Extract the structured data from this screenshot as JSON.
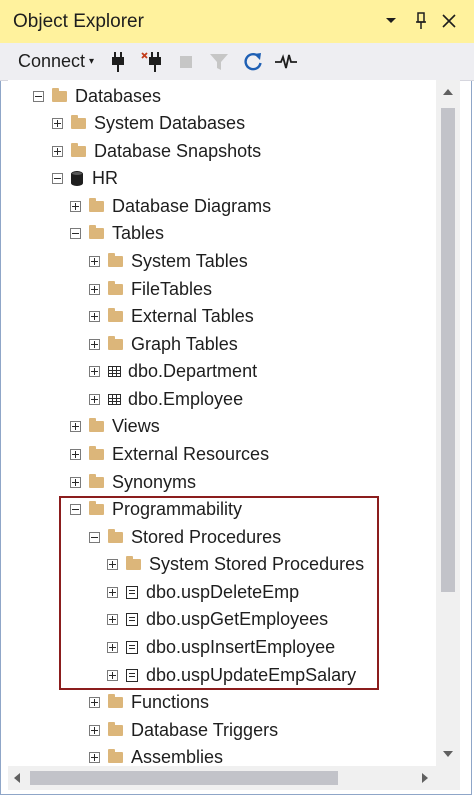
{
  "window": {
    "title": "Object Explorer",
    "dropdown_glyph": "▾",
    "pin_glyph": "📌",
    "close_glyph": "✕"
  },
  "toolbar": {
    "connect_label": "Connect",
    "caret": "▾",
    "icons": [
      "connect-plug-icon",
      "disconnect-plug-icon",
      "stop-icon",
      "filter-icon",
      "refresh-icon",
      "activity-monitor-icon"
    ]
  },
  "tree": {
    "databases": "Databases",
    "system_databases": "System Databases",
    "database_snapshots": "Database Snapshots",
    "hr": "HR",
    "database_diagrams": "Database Diagrams",
    "tables": "Tables",
    "system_tables": "System Tables",
    "file_tables": "FileTables",
    "external_tables": "External Tables",
    "graph_tables": "Graph Tables",
    "dbo_department": "dbo.Department",
    "dbo_employee": "dbo.Employee",
    "views": "Views",
    "external_resources": "External Resources",
    "synonyms": "Synonyms",
    "programmability": "Programmability",
    "stored_procedures": "Stored Procedures",
    "system_stored_procedures": "System Stored Procedures",
    "usp_delete_emp": "dbo.uspDeleteEmp",
    "usp_get_employees": "dbo.uspGetEmployees",
    "usp_insert_employee": "dbo.uspInsertEmployee",
    "usp_update_emp_salary": "dbo.uspUpdateEmpSalary",
    "functions": "Functions",
    "database_triggers": "Database Triggers",
    "assemblies": "Assemblies"
  },
  "colors": {
    "titlebar": "#fff29d",
    "toolbar": "#eeeef2",
    "folder": "#dcb67a",
    "highlight_border": "#8b1d1d",
    "refresh_blue": "#1e5fb4"
  }
}
